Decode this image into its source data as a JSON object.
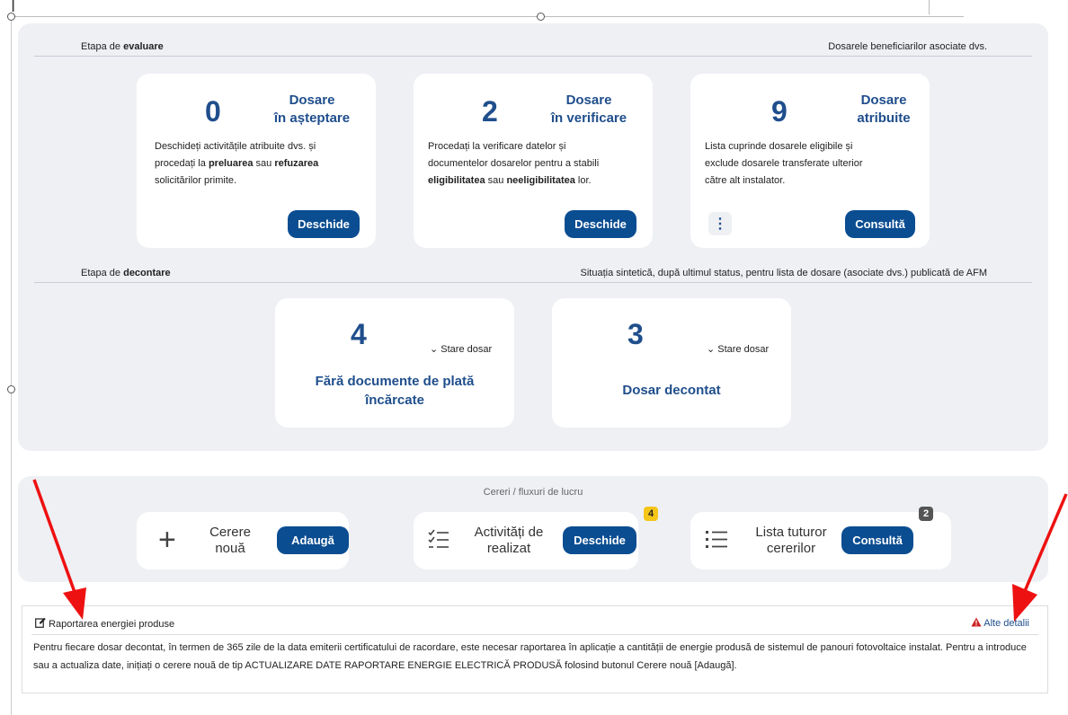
{
  "evaluare": {
    "label_prefix": "Etapa de ",
    "label_bold": "evaluare",
    "right_label": "Dosarele beneficiarilor asociate dvs.",
    "cards": [
      {
        "count": "0",
        "title_line1": "Dosare",
        "title_line2": "în așteptare",
        "desc": [
          "Deschideți activitățile atribuite dvs. și",
          "procedați la ",
          "preluarea",
          " sau ",
          "refuzarea",
          "solicitărilor primite."
        ],
        "button": "Deschide"
      },
      {
        "count": "2",
        "title_line1": "Dosare",
        "title_line2": "în verificare",
        "desc": [
          "Procedați la verificare datelor și",
          "documentelor dosarelor pentru a stabili",
          "eligibilitatea",
          " sau ",
          "neeligibilitatea",
          " lor."
        ],
        "button": "Deschide"
      },
      {
        "count": "9",
        "title_line1": "Dosare",
        "title_line2": "atribuite",
        "desc": [
          "Lista cuprinde dosarele eligibile și",
          "exclude dosarele transferate ulterior",
          "către alt instalator."
        ],
        "button": "Consultă"
      }
    ]
  },
  "decontare": {
    "label_prefix": "Etapa de ",
    "label_bold": "decontare",
    "right_label": "Situația sintetică, după ultimul status, pentru lista de dosare (asociate dvs.) publicată de AFM",
    "cards": [
      {
        "count": "4",
        "toggle": "Stare dosar",
        "title_line1": "Fără documente de plată",
        "title_line2": "încărcate"
      },
      {
        "count": "3",
        "toggle": "Stare dosar",
        "title_line1": "Dosar decontat",
        "title_line2": ""
      }
    ]
  },
  "workflow": {
    "label": "Cereri / fluxuri de lucru",
    "items": [
      {
        "line1": "Cerere",
        "line2": "nouă",
        "button": "Adaugă",
        "badge": ""
      },
      {
        "line1": "Activități de",
        "line2": "realizat",
        "button": "Deschide",
        "badge": "4"
      },
      {
        "line1": "Lista tuturor",
        "line2": "cererilor",
        "button": "Consultă",
        "badge": "2"
      }
    ]
  },
  "report": {
    "title": "Raportarea energiei produse",
    "link": "Alte detalii",
    "text": "Pentru fiecare dosar decontat, în termen de 365 zile de la data emiterii certificatului de racordare, este necesar raportarea în aplicație a cantității de energie produsă de sistemul de panouri fotovoltaice instalat. Pentru a introduce sau a actualiza date, inițiați o cerere nouă de tip ACTUALIZARE DATE RAPORTARE ENERGIE ELECTRICĂ PRODUSĂ folosind butonul Cerere nouă [Adaugă]."
  },
  "colors": {
    "accent": "#0b4d91",
    "title": "#1f4e8c",
    "badge_yellow": "#f5c518",
    "badge_gray": "#555555",
    "warning": "#cc2222",
    "arrow": "#ee1111"
  },
  "icons": [
    "plus-icon",
    "checklist-icon",
    "list-icon",
    "edit-icon",
    "warning-icon",
    "chevron-down-icon",
    "kebab-icon"
  ]
}
